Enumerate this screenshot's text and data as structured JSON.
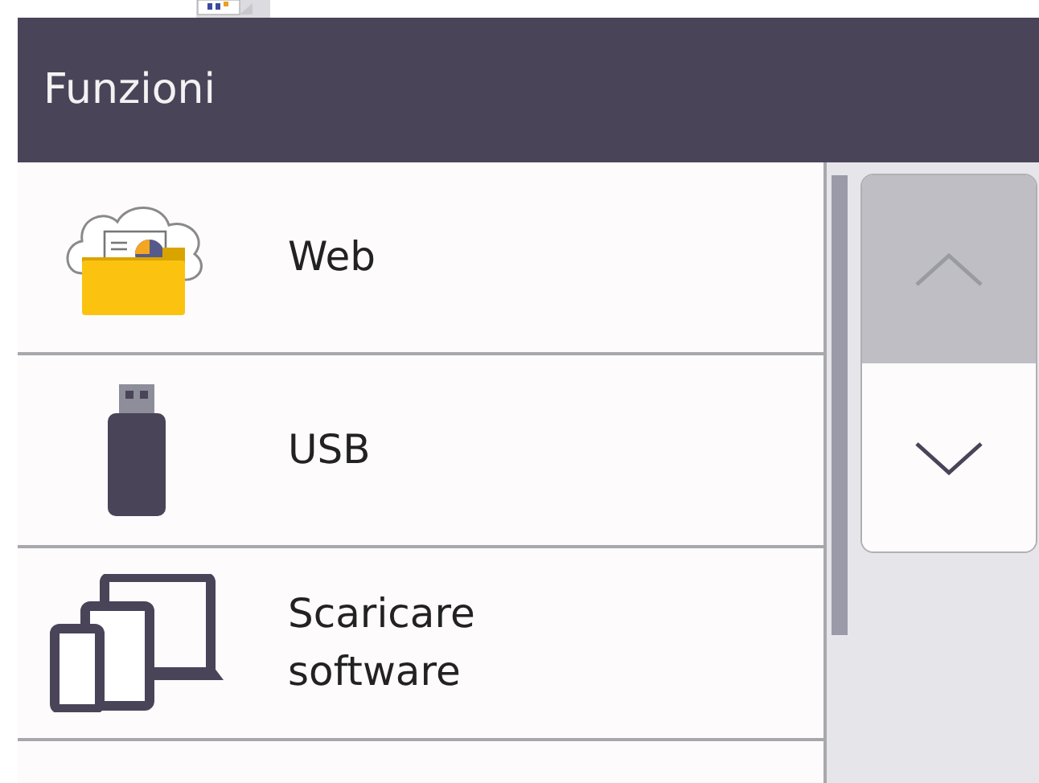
{
  "header": {
    "title": "Funzioni"
  },
  "items": [
    {
      "kind": "web",
      "label": "Web"
    },
    {
      "kind": "usb",
      "label": "USB"
    },
    {
      "kind": "software",
      "label": "Scaricare software"
    },
    {
      "kind": "partial"
    }
  ],
  "scroll_buttons": [
    {
      "kind": "up",
      "disabled": true
    },
    {
      "kind": "down",
      "disabled": false
    }
  ]
}
